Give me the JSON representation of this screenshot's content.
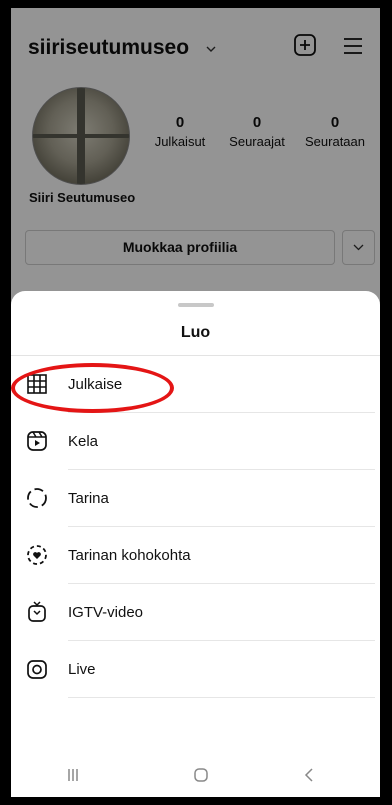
{
  "profile": {
    "username": "siiriseutumuseo",
    "name": "Siiri Seutumuseo",
    "stats": [
      {
        "count": "0",
        "label": "Julkaisut"
      },
      {
        "count": "0",
        "label": "Seuraajat"
      },
      {
        "count": "0",
        "label": "Seurataan"
      }
    ],
    "edit_profile_label": "Muokkaa profiilia"
  },
  "sheet": {
    "title": "Luo",
    "items": [
      {
        "label": "Julkaise",
        "icon": "grid-icon"
      },
      {
        "label": "Kela",
        "icon": "reels-icon"
      },
      {
        "label": "Tarina",
        "icon": "story-icon"
      },
      {
        "label": "Tarinan kohokohta",
        "icon": "highlight-icon"
      },
      {
        "label": "IGTV-video",
        "icon": "igtv-icon"
      },
      {
        "label": "Live",
        "icon": "live-camera-icon"
      }
    ]
  },
  "colors": {
    "annotation": "#e41515",
    "overlay": "rgba(0,0,0,0.42)"
  }
}
